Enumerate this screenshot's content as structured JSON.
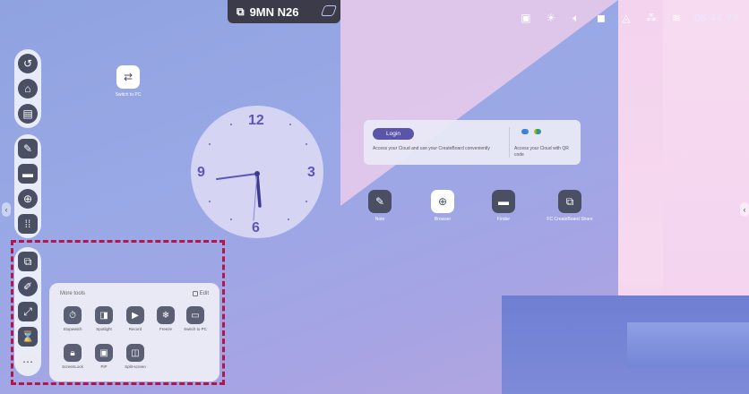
{
  "top": {
    "device_name": "9MN N26",
    "time": "05:44 ?? "
  },
  "status_icons": [
    "screen-share-icon",
    "brightness-icon",
    "volume-icon",
    "camera-icon",
    "hub-icon",
    "network-icon",
    "wifi-icon"
  ],
  "sidebar": {
    "group1": [
      "back-icon",
      "home-icon",
      "window-icon"
    ],
    "group2": [
      "whiteboard-icon",
      "folder-icon",
      "browser-icon",
      "apps-icon"
    ],
    "group3": [
      "screen-share-icon",
      "pen-icon",
      "annotate-icon",
      "timer-icon",
      "more-icon"
    ]
  },
  "desktop": {
    "switch_icon_label": "Switch to PC",
    "apps": [
      {
        "label": "Note",
        "icon": "note-icon"
      },
      {
        "label": "Browser",
        "icon": "browser-icon"
      },
      {
        "label": "Finder",
        "icon": "folder-icon"
      },
      {
        "label": "FC CreateBoard Share",
        "icon": "share-icon"
      }
    ]
  },
  "clock": {
    "numbers": {
      "twelve": "12",
      "three": "3",
      "six": "6",
      "nine": "9"
    }
  },
  "cloud_card": {
    "login_label": "Login",
    "description": "Access your Cloud and use your CreateBoard conveniently",
    "qr_description": "Access your Cloud with QR code"
  },
  "more_tools": {
    "title": "More tools",
    "edit_label": "Edit",
    "tools": [
      {
        "label": "Stopwatch",
        "icon": "stopwatch-icon"
      },
      {
        "label": "Spotlight",
        "icon": "spotlight-icon"
      },
      {
        "label": "Record",
        "icon": "record-icon"
      },
      {
        "label": "Freeze",
        "icon": "freeze-icon"
      },
      {
        "label": "Switch to PC",
        "icon": "monitor-icon"
      },
      {
        "label": "ScreenLock",
        "icon": "lock-icon"
      },
      {
        "label": "PiP",
        "icon": "pip-icon"
      },
      {
        "label": "Split-screen",
        "icon": "split-screen-icon"
      }
    ]
  },
  "colors": {
    "selection_border": "#b3164a",
    "accent": "#5a55a8"
  }
}
